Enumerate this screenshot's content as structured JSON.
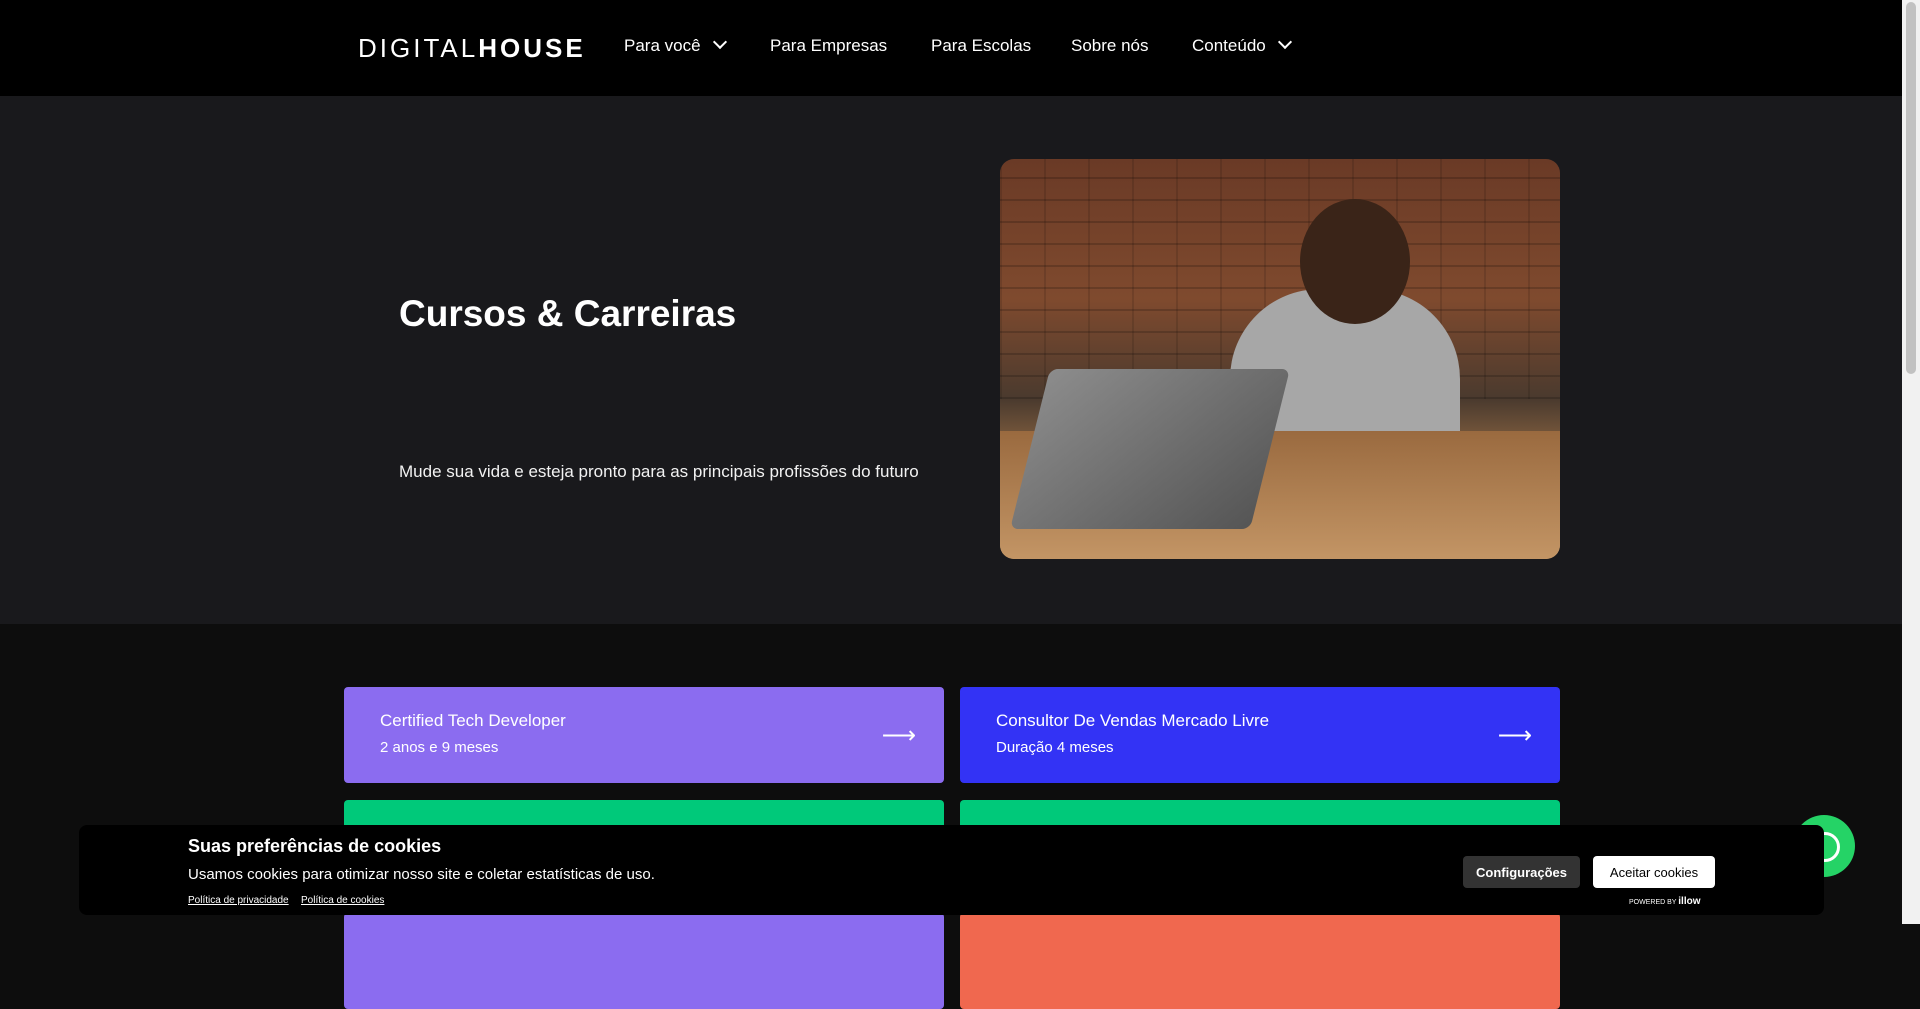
{
  "nav": {
    "logo_light": "DIGITAL",
    "logo_bold": "HOUSE",
    "items": [
      {
        "label": "Para você",
        "dropdown": true
      },
      {
        "label": "Para Empresas",
        "dropdown": false
      },
      {
        "label": "Para Escolas",
        "dropdown": false
      },
      {
        "label": "Sobre nós",
        "dropdown": false
      },
      {
        "label": "Conteúdo",
        "dropdown": true
      }
    ]
  },
  "hero": {
    "title": "Cursos & Carreiras",
    "subtitle": "Mude sua vida e esteja pronto para as principais profissões do futuro"
  },
  "courses": [
    {
      "title": "Certified Tech Developer",
      "subtitle": "2 anos e 9 meses",
      "color": "#8b6cf0",
      "icon": "arrow-right-icon"
    },
    {
      "title": "Consultor De Vendas Mercado Livre",
      "subtitle": "Duração 4 meses",
      "color": "#3333f5",
      "icon": "arrow-right-icon"
    },
    {
      "title": "",
      "subtitle": "",
      "color": "#00c97a"
    },
    {
      "title": "",
      "subtitle": "",
      "color": "#00c97a"
    },
    {
      "title": "",
      "subtitle": "",
      "color": "#8b6cf0"
    },
    {
      "title": "",
      "subtitle": "",
      "color": "#f0684f"
    }
  ],
  "cookie": {
    "title": "Suas preferências de cookies",
    "text": "Usamos cookies para otimizar nosso site e coletar estatísticas de uso.",
    "privacy_link": "Política de privacidade",
    "cookies_link": "Política de cookies",
    "config_button": "Configurações",
    "accept_button": "Aceitar cookies",
    "powered_by": "POWERED BY",
    "powered_brand": "illow"
  },
  "whatsapp": {
    "icon": "whatsapp-icon"
  },
  "colors": {
    "nav_bg": "#000000",
    "hero_bg": "#19191c",
    "page_bg": "#0d0d0d",
    "whatsapp": "#25d366"
  }
}
